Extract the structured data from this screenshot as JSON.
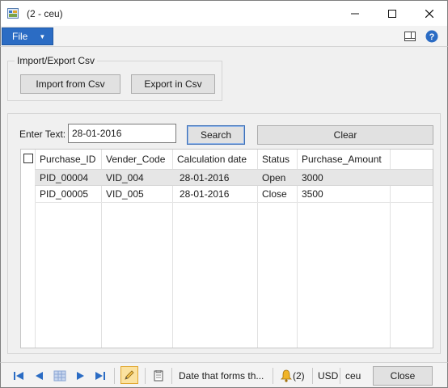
{
  "window": {
    "title": "(2 - ceu)"
  },
  "menu": {
    "file_label": "File"
  },
  "import_export": {
    "group_title": "Import/Export Csv",
    "import_label": "Import from Csv",
    "export_label": "Export in Csv"
  },
  "search": {
    "label": "Enter Text:",
    "value": "28-01-2016",
    "search_label": "Search",
    "clear_label": "Clear"
  },
  "grid": {
    "columns": [
      "Purchase_ID",
      "Vender_Code",
      "Calculation date",
      "Status",
      "Purchase_Amount"
    ],
    "rows": [
      [
        "PID_00004",
        "VID_004",
        "28-01-2016",
        "Open",
        "3000"
      ],
      [
        "PID_00005",
        "VID_005",
        "28-01-2016",
        "Close",
        "3500"
      ]
    ]
  },
  "statusbar": {
    "help_text": "Date that forms th...",
    "notifications": "(2)",
    "currency": "USD",
    "company": "ceu",
    "close_label": "Close"
  },
  "colors": {
    "accent": "#2b6cc4",
    "selected_row": "#e6e6e6",
    "edit_highlight": "#fbe2a0"
  }
}
